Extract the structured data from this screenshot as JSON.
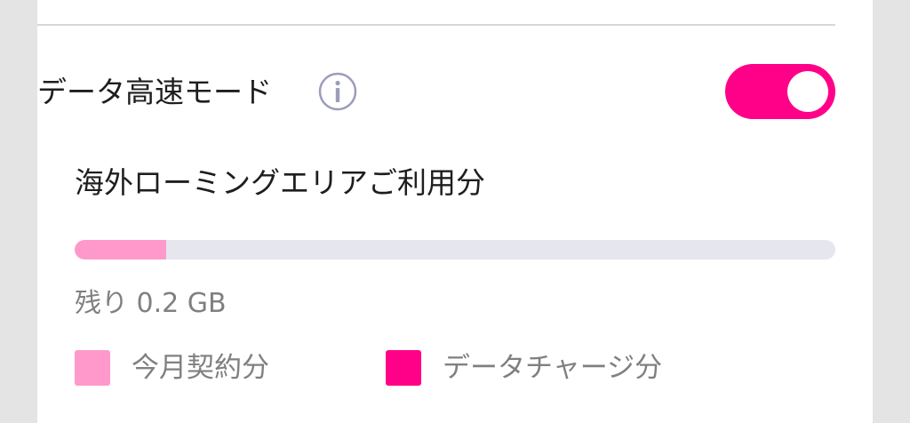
{
  "data_mode": {
    "label": "データ高速モード",
    "info_icon": "info-circle-icon",
    "toggle_on": true
  },
  "roaming_usage": {
    "title": "海外ローミングエリアご利用分",
    "progress_fraction": 0.12,
    "remaining_text": "残り 0.2 GB"
  },
  "legend": [
    {
      "label": "今月契約分",
      "color": "#ff99cc"
    },
    {
      "label": "データチャージ分",
      "color": "#ff0088"
    }
  ],
  "colors": {
    "accent": "#ff0088",
    "monthly_plan": "#ff99cc",
    "track": "#e6e6ef",
    "info_icon": "#9c9cbc"
  }
}
